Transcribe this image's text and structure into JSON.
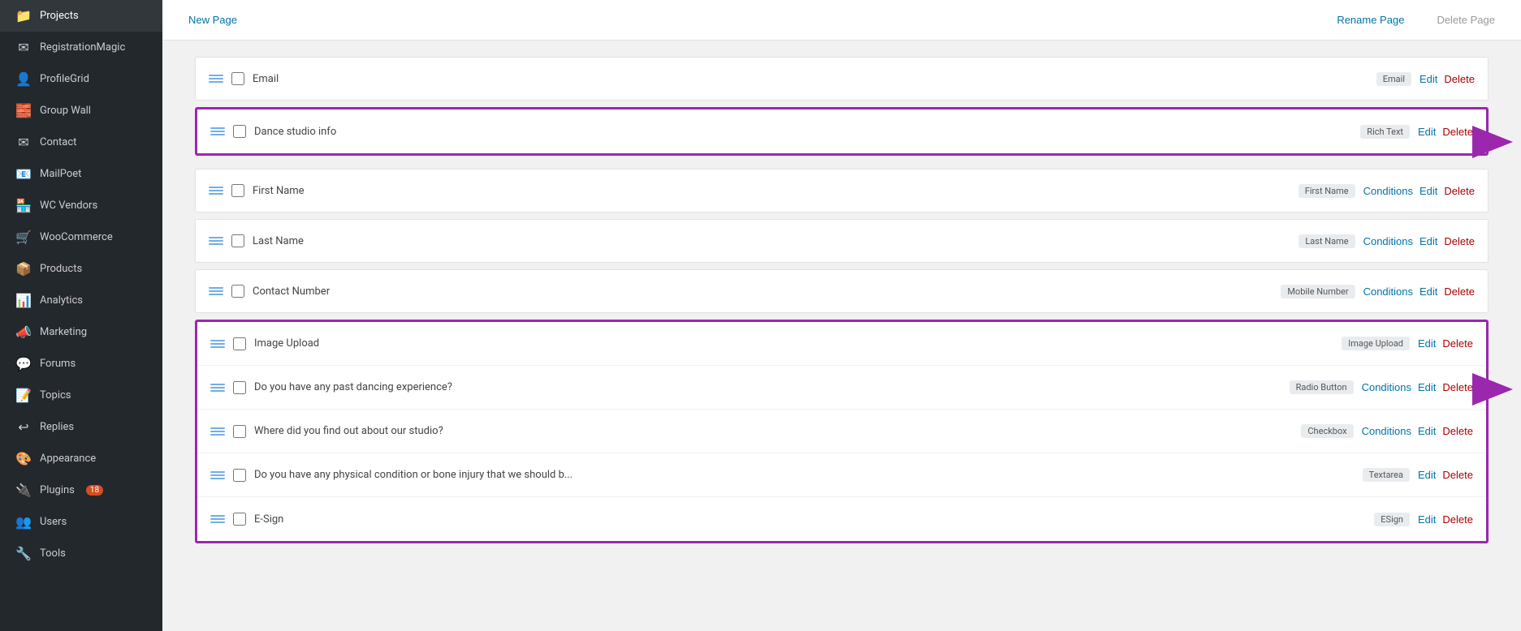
{
  "sidebar": {
    "items": [
      {
        "id": "projects",
        "label": "Projects",
        "icon": "📁"
      },
      {
        "id": "registrationmagic",
        "label": "RegistrationMagic",
        "icon": "✉"
      },
      {
        "id": "profilegrid",
        "label": "ProfileGrid",
        "icon": "👤"
      },
      {
        "id": "group-wall",
        "label": "Group Wall",
        "icon": "🧱"
      },
      {
        "id": "contact",
        "label": "Contact",
        "icon": "✉"
      },
      {
        "id": "mailpoet",
        "label": "MailPoet",
        "icon": "📧"
      },
      {
        "id": "wc-vendors",
        "label": "WC Vendors",
        "icon": "🏪"
      },
      {
        "id": "woocommerce",
        "label": "WooCommerce",
        "icon": "🛒"
      },
      {
        "id": "products",
        "label": "Products",
        "icon": "📦"
      },
      {
        "id": "analytics",
        "label": "Analytics",
        "icon": "📊"
      },
      {
        "id": "marketing",
        "label": "Marketing",
        "icon": "📣"
      },
      {
        "id": "forums",
        "label": "Forums",
        "icon": "💬"
      },
      {
        "id": "topics",
        "label": "Topics",
        "icon": "📝"
      },
      {
        "id": "replies",
        "label": "Replies",
        "icon": "↩"
      },
      {
        "id": "appearance",
        "label": "Appearance",
        "icon": "🎨"
      },
      {
        "id": "plugins",
        "label": "Plugins",
        "icon": "🔌",
        "badge": "18"
      },
      {
        "id": "users",
        "label": "Users",
        "icon": "👥"
      },
      {
        "id": "tools",
        "label": "Tools",
        "icon": "🔧"
      }
    ]
  },
  "toolbar": {
    "new_page": "New Page",
    "rename_page": "Rename Page",
    "delete_page": "Delete Page"
  },
  "fields": {
    "standalone_rows": [
      {
        "id": "email",
        "name": "Email",
        "tag": "Email",
        "actions": [
          "Edit",
          "Delete"
        ],
        "has_conditions": false
      }
    ],
    "group1": {
      "purple": true,
      "rows": [
        {
          "id": "dance-studio-info",
          "name": "Dance studio info",
          "tag": "Rich Text",
          "actions": [
            "Edit",
            "Delete"
          ],
          "has_conditions": false
        }
      ]
    },
    "middle_rows": [
      {
        "id": "first-name",
        "name": "First Name",
        "tag": "First Name",
        "actions": [
          "Conditions",
          "Edit",
          "Delete"
        ],
        "has_conditions": true
      },
      {
        "id": "last-name",
        "name": "Last Name",
        "tag": "Last Name",
        "actions": [
          "Conditions",
          "Edit",
          "Delete"
        ],
        "has_conditions": true
      },
      {
        "id": "contact-number",
        "name": "Contact Number",
        "tag": "Mobile Number",
        "actions": [
          "Conditions",
          "Edit",
          "Delete"
        ],
        "has_conditions": true
      }
    ],
    "group2": {
      "purple": true,
      "rows": [
        {
          "id": "image-upload",
          "name": "Image Upload",
          "tag": "Image Upload",
          "actions": [
            "Edit",
            "Delete"
          ],
          "has_conditions": false
        },
        {
          "id": "dancing-experience",
          "name": "Do you have any past dancing experience?",
          "tag": "Radio Button",
          "actions": [
            "Conditions",
            "Edit",
            "Delete"
          ],
          "has_conditions": true
        },
        {
          "id": "find-studio",
          "name": "Where did you find out about our studio?",
          "tag": "Checkbox",
          "actions": [
            "Conditions",
            "Edit",
            "Delete"
          ],
          "has_conditions": true
        },
        {
          "id": "physical-condition",
          "name": "Do you have any physical condition or bone injury that we should b...",
          "tag": "Textarea",
          "actions": [
            "Edit",
            "Delete"
          ],
          "has_conditions": false
        },
        {
          "id": "e-sign",
          "name": "E-Sign",
          "tag": "ESign",
          "actions": [
            "Edit",
            "Delete"
          ],
          "has_conditions": false
        }
      ]
    }
  },
  "arrows": {
    "arrow1_top": "130",
    "arrow2_top": "460"
  }
}
